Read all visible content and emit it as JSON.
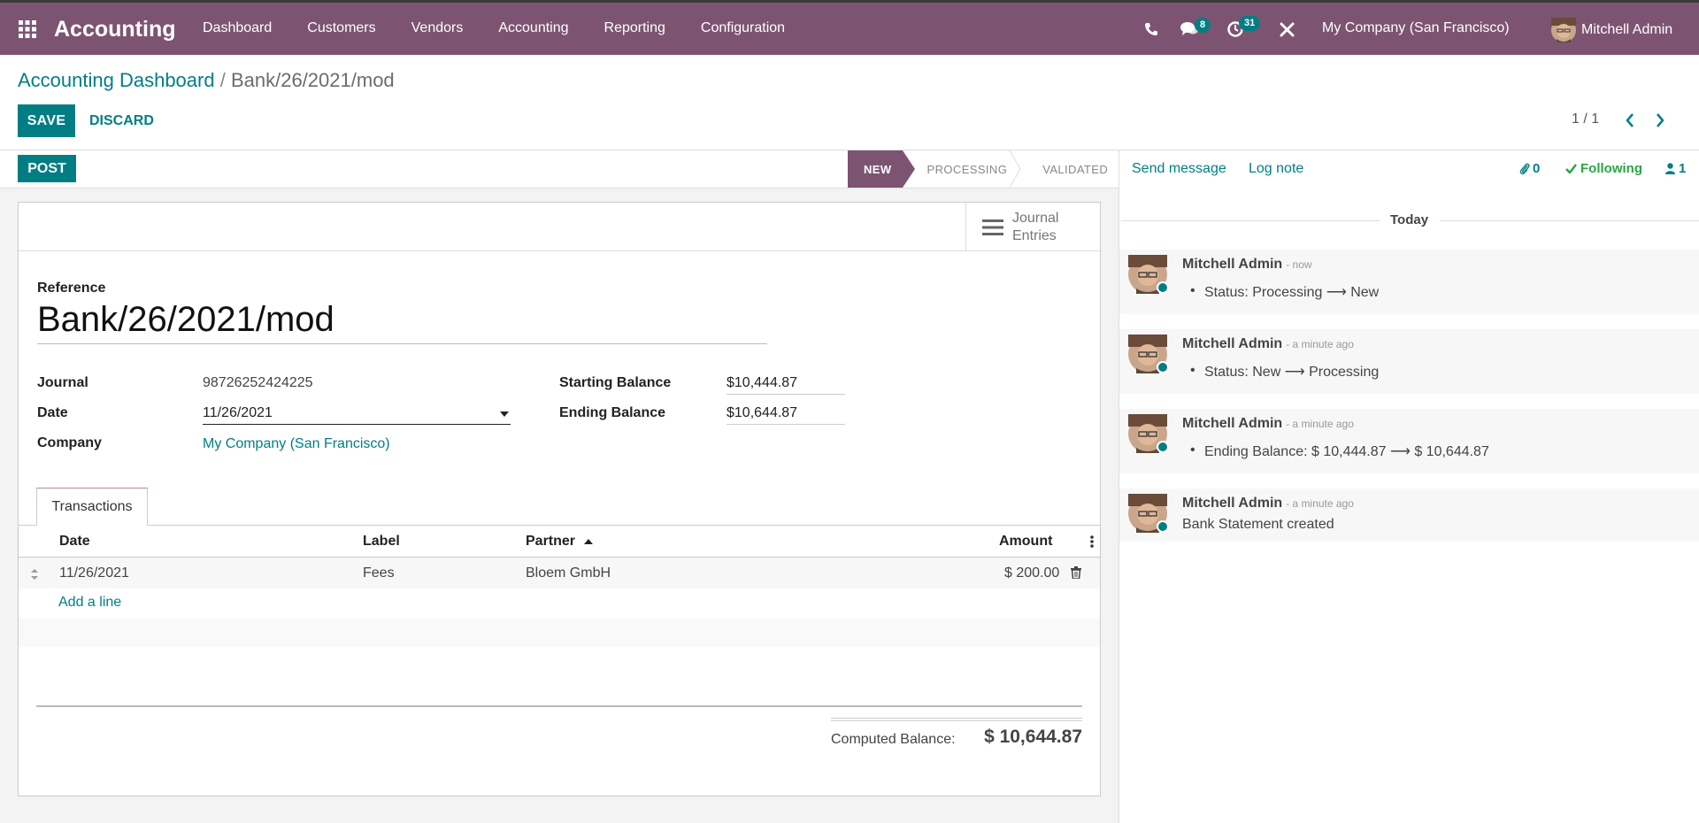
{
  "nav": {
    "app_name": "Accounting",
    "menu": [
      "Dashboard",
      "Customers",
      "Vendors",
      "Accounting",
      "Reporting",
      "Configuration"
    ],
    "messages_count": "8",
    "activities_count": "31",
    "company": "My Company (San Francisco)",
    "user": "Mitchell Admin"
  },
  "breadcrumb": {
    "parent": "Accounting Dashboard",
    "separator": "/",
    "current": "Bank/26/2021/mod"
  },
  "actions": {
    "save": "SAVE",
    "discard": "DISCARD"
  },
  "pager": {
    "value": "1 / 1"
  },
  "statusbar": {
    "post": "POST",
    "steps": [
      "NEW",
      "PROCESSING",
      "VALIDATED"
    ],
    "active_step": "NEW"
  },
  "smart_button": {
    "line1": "Journal",
    "line2": "Entries"
  },
  "form": {
    "reference_label": "Reference",
    "reference": "Bank/26/2021/mod",
    "journal_label": "Journal",
    "journal": "98726252424225",
    "date_label": "Date",
    "date": "11/26/2021",
    "company_label": "Company",
    "company": "My Company (San Francisco)",
    "starting_balance_label": "Starting Balance",
    "starting_balance": "$10,444.87",
    "ending_balance_label": "Ending Balance",
    "ending_balance": "$10,644.87"
  },
  "tabs": {
    "transactions": "Transactions"
  },
  "table": {
    "columns": {
      "date": "Date",
      "label": "Label",
      "partner": "Partner",
      "amount": "Amount"
    },
    "rows": [
      {
        "date": "11/26/2021",
        "label": "Fees",
        "partner": "Bloem GmbH",
        "amount": "$ 200.00"
      }
    ],
    "add_line": "Add a line"
  },
  "totals": {
    "computed_label": "Computed Balance:",
    "computed_value": "$ 10,644.87"
  },
  "chatter": {
    "send_message": "Send message",
    "log_note": "Log note",
    "attachments": "0",
    "following": "Following",
    "followers": "1",
    "date_separator": "Today",
    "messages": [
      {
        "author": "Mitchell Admin",
        "when": "- now",
        "change": "Status: Processing ⟶ New"
      },
      {
        "author": "Mitchell Admin",
        "when": "- a minute ago",
        "change": "Status: New ⟶ Processing"
      },
      {
        "author": "Mitchell Admin",
        "when": "- a minute ago",
        "change": "Ending Balance: $ 10,444.87 ⟶ $ 10,644.87"
      },
      {
        "author": "Mitchell Admin",
        "when": "- a minute ago",
        "body": "Bank Statement created"
      }
    ]
  },
  "colors": {
    "brand": "#7c5472",
    "accent": "#017e84"
  }
}
